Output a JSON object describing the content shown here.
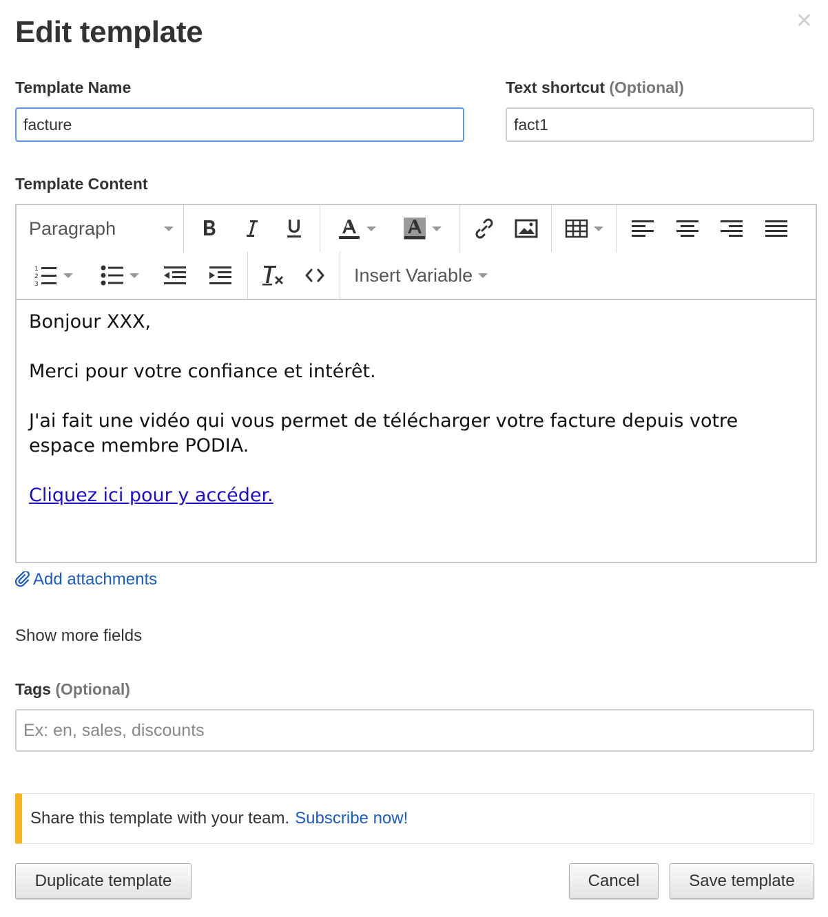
{
  "dialog": {
    "title": "Edit template",
    "close_icon": "close-icon"
  },
  "template_name": {
    "label": "Template Name",
    "value": "facture"
  },
  "text_shortcut": {
    "label": "Text shortcut",
    "optional": "(Optional)",
    "value": "fact1"
  },
  "template_content": {
    "label": "Template Content"
  },
  "toolbar": {
    "paragraph_label": "Paragraph",
    "insert_variable_label": "Insert Variable",
    "icons": [
      "bold-icon",
      "italic-icon",
      "underline-icon",
      "text-color-icon",
      "background-color-icon",
      "link-icon",
      "image-icon",
      "table-icon",
      "align-left-icon",
      "align-center-icon",
      "align-right-icon",
      "align-justify-icon",
      "numbered-list-icon",
      "bullet-list-icon",
      "outdent-icon",
      "indent-icon",
      "clear-formatting-icon",
      "source-code-icon"
    ]
  },
  "editor": {
    "line1": "Bonjour XXX,",
    "line2": "Merci pour votre confiance et intérêt.",
    "line3": "J'ai fait une vidéo qui vous permet de télécharger votre facture depuis votre espace membre PODIA.",
    "link_text": "Cliquez ici pour y accéder.",
    "link_color": "#1a0dcc"
  },
  "attachments": {
    "label": "Add attachments",
    "icon": "paperclip-icon"
  },
  "show_more": "Show more fields",
  "tags": {
    "label": "Tags",
    "optional": "(Optional)",
    "placeholder": "Ex: en, sales, discounts"
  },
  "banner": {
    "text": "Share this template with your team.",
    "link": "Subscribe now!",
    "accent_color": "#f8b21b"
  },
  "buttons": {
    "duplicate": "Duplicate template",
    "cancel": "Cancel",
    "save": "Save template"
  }
}
